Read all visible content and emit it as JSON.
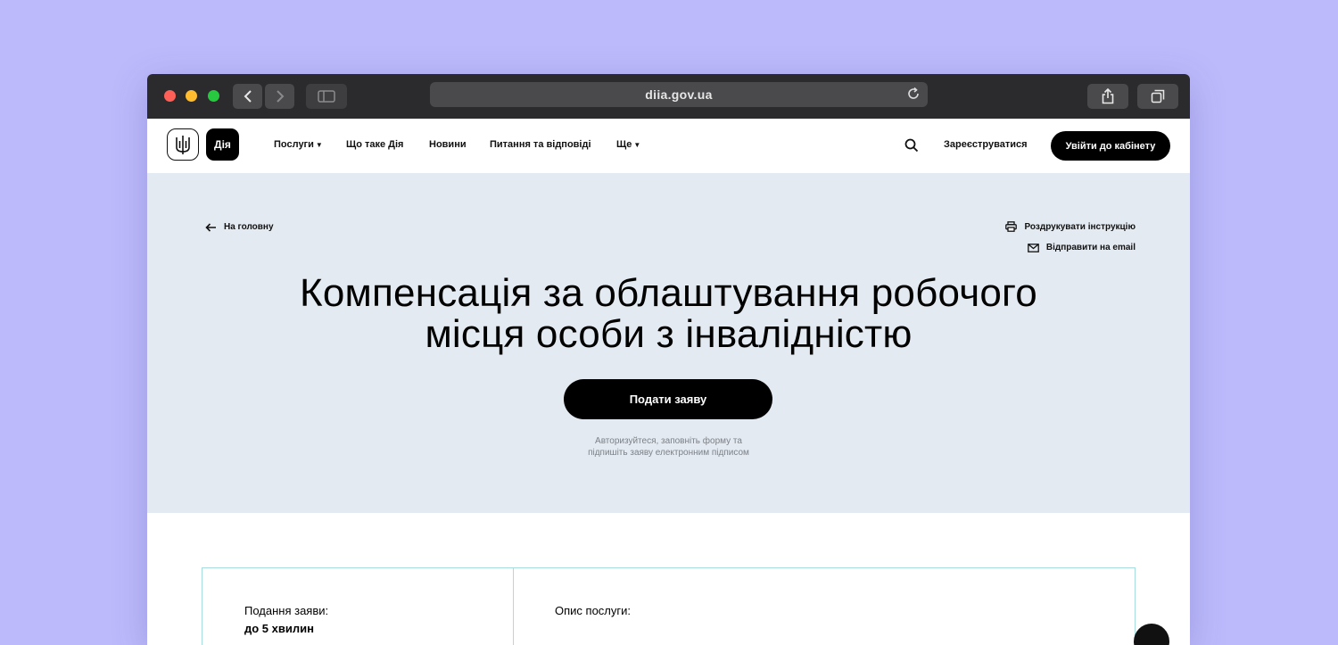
{
  "browser": {
    "url": "diia.gov.ua"
  },
  "header": {
    "logo_text": "Дія",
    "nav": [
      {
        "label": "Послуги",
        "has_caret": true
      },
      {
        "label": "Що таке Дія"
      },
      {
        "label": "Новини"
      },
      {
        "label": "Питання та відповіді"
      },
      {
        "label": "Ще",
        "has_caret": true
      }
    ],
    "register_label": "Зареєструватися",
    "login_label": "Увійти до кабінету"
  },
  "hero": {
    "back_label": "На головну",
    "print_label": "Роздрукувати інструкцію",
    "email_label": "Відправити на email",
    "title_line1": "Компенсація за облаштування робочого",
    "title_line2": "місця особи з інвалідністю",
    "apply_label": "Подати заяву",
    "hint_line1": "Авторизуйтеся, заповніть форму та",
    "hint_line2": "підпишіть заяву електронним підписом"
  },
  "card": {
    "left_label": "Подання заяви:",
    "left_value": "до 5 хвилин",
    "right_label": "Опис послуги:"
  },
  "colors": {
    "background": "#bcbafb",
    "hero_bg": "#e3eaf1",
    "primary": "#000000",
    "card_border": "#a9dcdf"
  }
}
